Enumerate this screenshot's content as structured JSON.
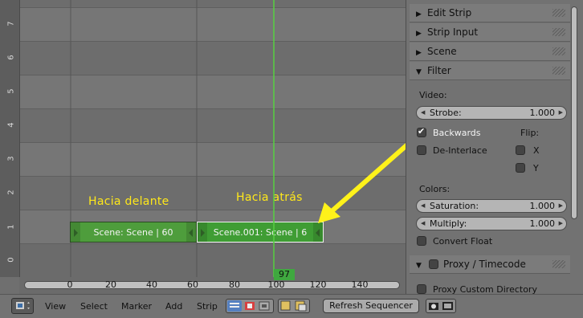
{
  "sequencer": {
    "channel_labels": [
      "0",
      "1",
      "2",
      "3",
      "4",
      "5",
      "6",
      "7"
    ],
    "frame_ticks": [
      "0",
      "20",
      "40",
      "60",
      "80",
      "100",
      "120",
      "140"
    ],
    "current_frame": "97",
    "annotations": {
      "forward": "Hacia delante",
      "backward": "Hacia atrás"
    },
    "strips": [
      {
        "label": "Scene: Scene | 60",
        "selected": false
      },
      {
        "label": "Scene.001: Scene | 6",
        "selected": true
      }
    ],
    "colors": {
      "strip": "#4e9d3c",
      "playhead": "#56d040",
      "annotation": "#ffe81a",
      "arrow": "#fff21a"
    }
  },
  "panel": {
    "sections": [
      {
        "title": "Edit Strip",
        "expanded": false
      },
      {
        "title": "Strip Input",
        "expanded": false
      },
      {
        "title": "Scene",
        "expanded": false
      },
      {
        "title": "Filter",
        "expanded": true
      }
    ],
    "filter": {
      "video_label": "Video:",
      "strobe_label": "Strobe:",
      "strobe_value": "1.000",
      "backwards_label": "Backwards",
      "backwards_checked": true,
      "flip_label": "Flip:",
      "deinterlace_label": "De-Interlace",
      "flip_x": "X",
      "flip_y": "Y",
      "colors_label": "Colors:",
      "saturation_label": "Saturation:",
      "saturation_value": "1.000",
      "multiply_label": "Multiply:",
      "multiply_value": "1.000",
      "convert_float_label": "Convert Float"
    },
    "proxy": {
      "title": "Proxy / Timecode",
      "custom_dir_label": "Proxy Custom Directory"
    }
  },
  "header": {
    "menus": [
      "View",
      "Select",
      "Marker",
      "Add",
      "Strip"
    ],
    "refresh_label": "Refresh Sequencer"
  }
}
